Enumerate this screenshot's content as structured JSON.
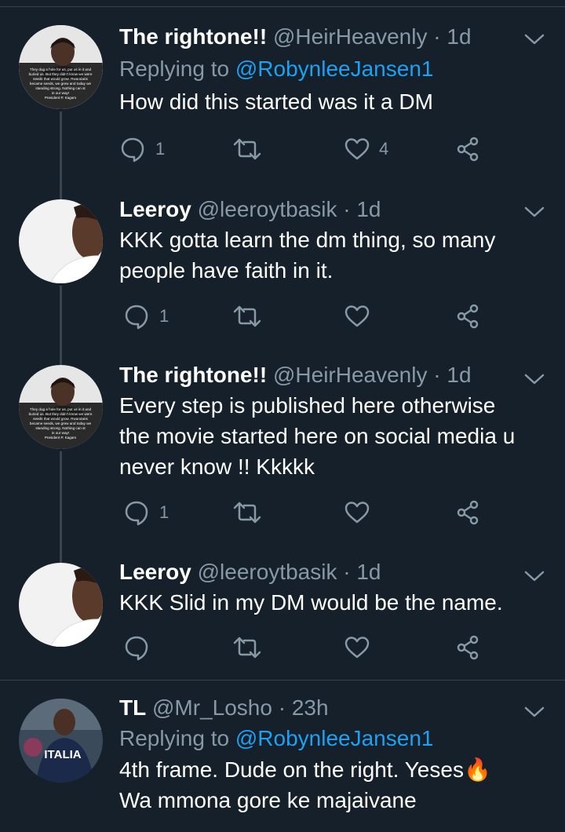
{
  "theme": {
    "background": "#15202b",
    "text": "#ffffff",
    "muted": "#8899a6",
    "accent": "#1da1f2",
    "divider": "#38444d"
  },
  "tweets": [
    {
      "name": "The rightone!!",
      "handle": "@HeirHeavenly",
      "dot": "·",
      "time": "1d",
      "replying_prefix": "Replying to",
      "replying_to": "@RobynleeJansen1",
      "lines": [
        "How did this started was it a DM"
      ],
      "reply_count": "1",
      "retweet_count": "",
      "like_count": "4",
      "avatar_icon": "person-with-quote-avatar",
      "avatar_quote": [
        "They dug a hole for us, put us in it and",
        "buried us. But they didn't know we were",
        "seeds that would grow. Rwandans",
        "became seeds, we grew and today we",
        "standing strong. Nothing can st",
        "in our way!",
        "President P. Kagam"
      ]
    },
    {
      "name": "Leeroy",
      "handle": "@leeroytbasik",
      "dot": "·",
      "time": "1d",
      "lines": [
        "KKK gotta learn the dm thing, so many",
        "people have faith in it."
      ],
      "reply_count": "1",
      "retweet_count": "",
      "like_count": "",
      "avatar_icon": "person-avatar"
    },
    {
      "name": "The rightone!!",
      "handle": "@HeirHeavenly",
      "dot": "·",
      "time": "1d",
      "lines": [
        "Every step is published here otherwise",
        "the movie started here on social media u",
        "never know !! Kkkkk"
      ],
      "reply_count": "1",
      "retweet_count": "",
      "like_count": "",
      "avatar_icon": "person-with-quote-avatar",
      "avatar_quote": [
        "They dug a hole for us, put us in it and",
        "buried us. But they didn't know we were",
        "seeds that would grow. Rwandans",
        "became seeds, we grew and today we",
        "standing strong. Nothing can st",
        "in our way!",
        "President P. Kagam"
      ]
    },
    {
      "name": "Leeroy",
      "handle": "@leeroytbasik",
      "dot": "·",
      "time": "1d",
      "lines": [
        "KKK Slid in my DM would be the name."
      ],
      "reply_count": "",
      "retweet_count": "",
      "like_count": "",
      "avatar_icon": "person-avatar"
    },
    {
      "name": "TL",
      "handle": "@Mr_Losho",
      "dot": "·",
      "time": "23h",
      "replying_prefix": "Replying to",
      "replying_to": "@RobynleeJansen1",
      "lines": [
        "4th frame. Dude on the right. Yeses",
        "Wa mmona gore ke majaivane"
      ],
      "emoji": "🔥",
      "avatar_icon": "person-in-italia-shirt-avatar",
      "avatar_text": "ITALIA"
    }
  ]
}
